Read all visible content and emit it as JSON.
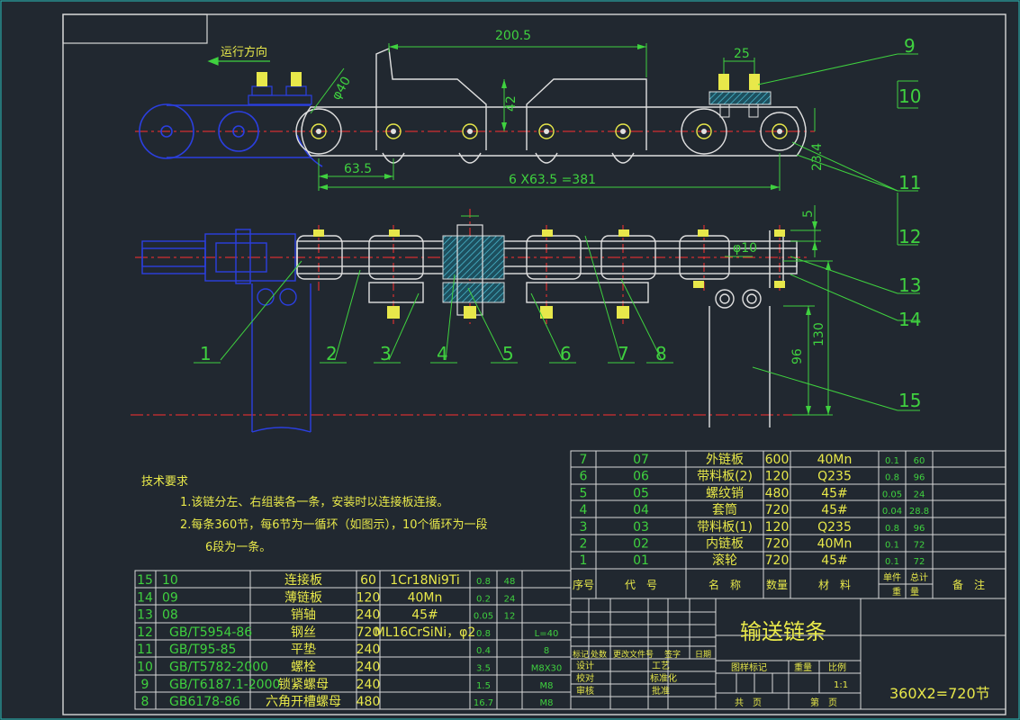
{
  "direction_label": "运行方向",
  "dims": {
    "d200": "200.5",
    "d25": "25",
    "d42": "42",
    "d40": "φ40",
    "d63": "63.5",
    "d381": "6 X63.5 =381",
    "d23": "23.4",
    "d5": "5",
    "d10": "φ10",
    "d130": "130",
    "d96": "96"
  },
  "balloons": [
    "1",
    "2",
    "3",
    "4",
    "5",
    "6",
    "7",
    "8",
    "9",
    "10",
    "11",
    "12",
    "13",
    "14",
    "15"
  ],
  "tech_req": {
    "title": "技术要求",
    "lines": [
      "1.该链分左、右组装各一条，安装时以连接板连接。",
      "2.每条360节，每6节为一循环（如图示），10个循环为一段",
      "6段为一条。"
    ]
  },
  "parts_upper": [
    [
      "7",
      "07",
      "外链板",
      "600",
      "40Mn",
      "0.1",
      "60"
    ],
    [
      "6",
      "06",
      "带料板(2)",
      "120",
      "Q235",
      "0.8",
      "96"
    ],
    [
      "5",
      "05",
      "螺纹销",
      "480",
      "45#",
      "0.05",
      "24"
    ],
    [
      "4",
      "04",
      "套筒",
      "720",
      "45#",
      "0.04",
      "28.8"
    ],
    [
      "3",
      "03",
      "带料板(1)",
      "120",
      "Q235",
      "0.8",
      "96"
    ],
    [
      "2",
      "02",
      "内链板",
      "720",
      "40Mn",
      "0.1",
      "72"
    ],
    [
      "1",
      "01",
      "滚轮",
      "720",
      "45#",
      "0.1",
      "72"
    ]
  ],
  "parts_header": {
    "no": "序号",
    "code": "代　号",
    "name": "名　称",
    "qty": "数量",
    "material": "材　料",
    "unit": "单件",
    "total": "总计",
    "weight": "重　量",
    "remark": "备　注"
  },
  "parts_lower": [
    [
      "15",
      "10",
      "",
      "连接板",
      "60",
      "1Cr18Ni9Ti",
      "0.8",
      "48",
      ""
    ],
    [
      "14",
      "09",
      "",
      "薄链板",
      "120",
      "40Mn",
      "0.2",
      "24",
      ""
    ],
    [
      "13",
      "08",
      "",
      "销轴",
      "240",
      "45#",
      "0.05",
      "12",
      ""
    ],
    [
      "12",
      "GB/T5954-86",
      "",
      "钢丝",
      "720",
      "ML16CrSiNi，φ2",
      "0.8",
      "",
      "L=40"
    ],
    [
      "11",
      "GB/T95-85",
      "",
      "平垫",
      "240",
      "",
      "0.4",
      "",
      "8"
    ],
    [
      "10",
      "GB/T5782-2000",
      "",
      "螺栓",
      "240",
      "",
      "3.5",
      "",
      "M8X30"
    ],
    [
      "9",
      "GB/T6187.1-2000",
      "",
      "锁紧螺母",
      "240",
      "",
      "1.5",
      "",
      "M8"
    ],
    [
      "8",
      "GB6178-86",
      "",
      "六角开槽螺母",
      "480",
      "",
      "16.7",
      "",
      "M8"
    ]
  ],
  "title_block": {
    "title": "输送链条",
    "sign_row": [
      "标记",
      "处数",
      "更改文件号",
      "签字",
      "日期"
    ],
    "roles": [
      "设计",
      "校对",
      "审核",
      "工艺",
      "标准化",
      "批准"
    ],
    "stage_mark": "图样标记",
    "weight": "重量",
    "scale": "比例",
    "scale_value": "1:1",
    "sheets": "共　页",
    "sheet": "第　页",
    "note": "360X2=720节"
  },
  "colors": {
    "background": "#212830",
    "frame": "#d8d8d8",
    "dimension": "#3fd13f",
    "part": "#e0e0e0",
    "pin": "#e8e84a",
    "centerline": "#ff3030",
    "hatch": "#3ab0c8",
    "blue_part": "#2b3fe0"
  }
}
